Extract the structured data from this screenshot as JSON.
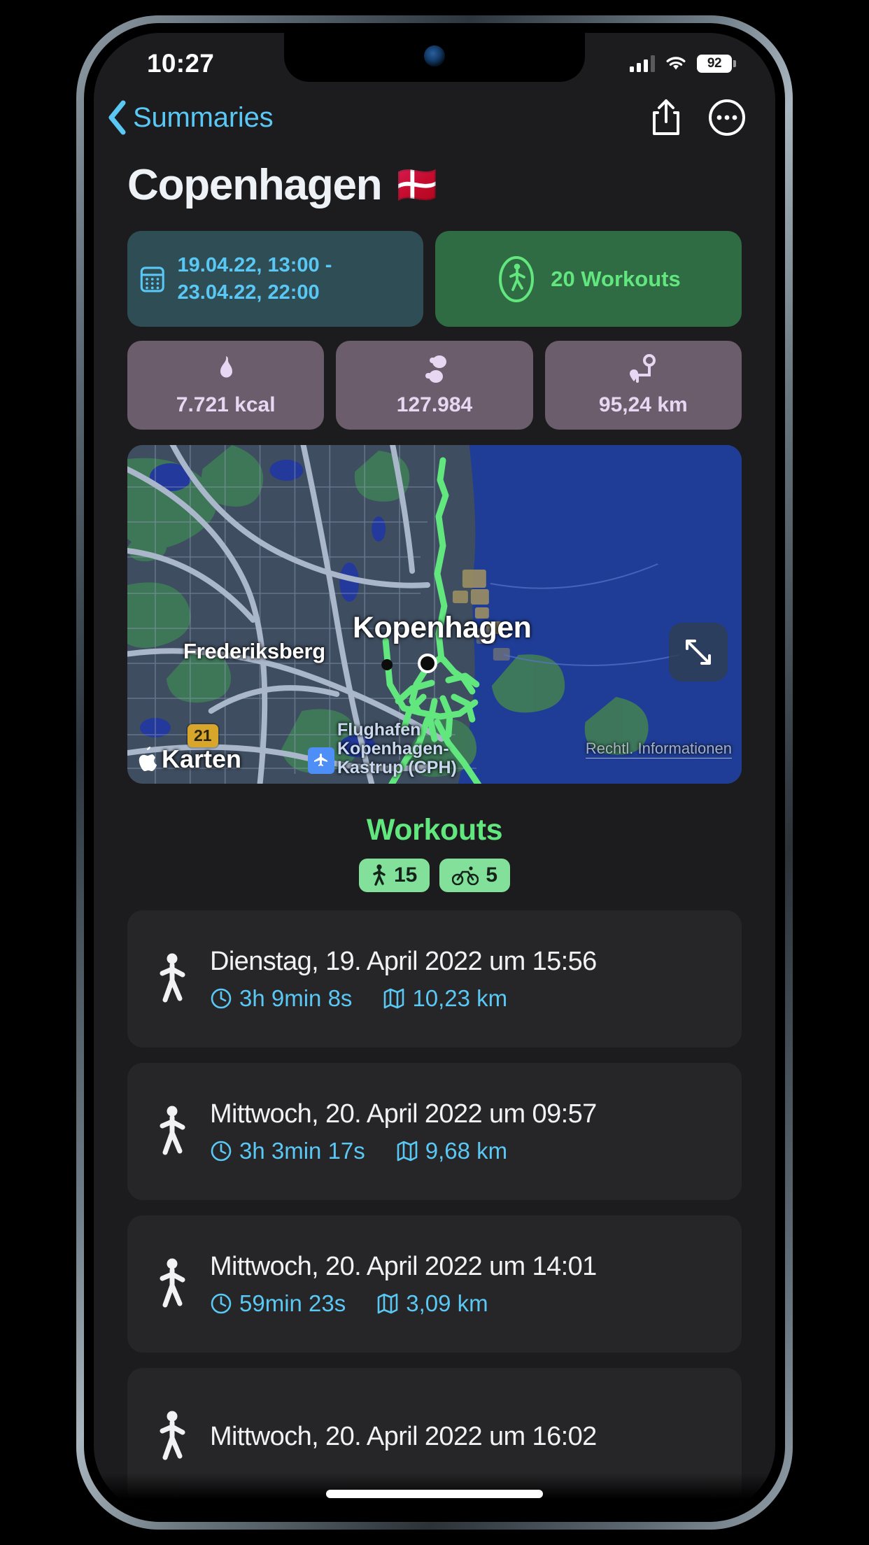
{
  "status_bar": {
    "time": "10:27",
    "battery_percent": "92",
    "signal_icon": "cellular-bars-icon",
    "wifi_icon": "wifi-icon"
  },
  "nav": {
    "back_label": "Summaries",
    "back_icon": "chevron-left-icon",
    "share_icon": "share-icon",
    "more_icon": "ellipsis-circle-icon"
  },
  "header": {
    "title": "Copenhagen",
    "flag": "🇩🇰"
  },
  "summary": {
    "date_range": "19.04.22, 13:00 - 23.04.22, 22:00",
    "date_icon": "calendar-icon",
    "workouts_count": "20 Workouts",
    "workouts_icon": "walking-figure-icon",
    "stats": [
      {
        "icon": "flame-icon",
        "value": "7.721 kcal"
      },
      {
        "icon": "footsteps-icon",
        "value": "127.984"
      },
      {
        "icon": "route-icon",
        "value": "95,24 km"
      }
    ]
  },
  "map": {
    "labels": {
      "city": "Kopenhagen",
      "district": "Frederiksberg",
      "airport": "Flughafen\nKopenhagen-\nKastrup (CPH)",
      "attribution": "Karten",
      "legal": "Rechtl. Informationen",
      "road_badge": "21"
    },
    "expand_icon": "expand-arrows-icon",
    "airport_icon": "airplane-icon",
    "apple_icon": "apple-logo-icon",
    "track_color": "#62e67e"
  },
  "workouts_section": {
    "heading": "Workouts",
    "badges": [
      {
        "icon": "walking-figure-icon",
        "count": "15"
      },
      {
        "icon": "bicycle-icon",
        "count": "5"
      }
    ]
  },
  "workouts": [
    {
      "icon": "walking-figure-icon",
      "title": "Dienstag, 19. April 2022 um 15:56",
      "duration": "3h 9min 8s",
      "distance": "10,23 km"
    },
    {
      "icon": "walking-figure-icon",
      "title": "Mittwoch, 20. April 2022 um 09:57",
      "duration": "3h 3min 17s",
      "distance": "9,68 km"
    },
    {
      "icon": "walking-figure-icon",
      "title": "Mittwoch, 20. April 2022 um 14:01",
      "duration": "59min 23s",
      "distance": "3,09 km"
    },
    {
      "icon": "walking-figure-icon",
      "title": "Mittwoch, 20. April 2022 um 16:02",
      "duration": "",
      "distance": ""
    }
  ],
  "colors": {
    "accent_blue": "#5ac8f5",
    "accent_green": "#62e67e",
    "stat_card": "#6b5d6b",
    "date_card": "#2f4d55",
    "workout_card": "#2f6b43",
    "list_card": "#262628",
    "screen_bg": "#1c1c1e"
  }
}
